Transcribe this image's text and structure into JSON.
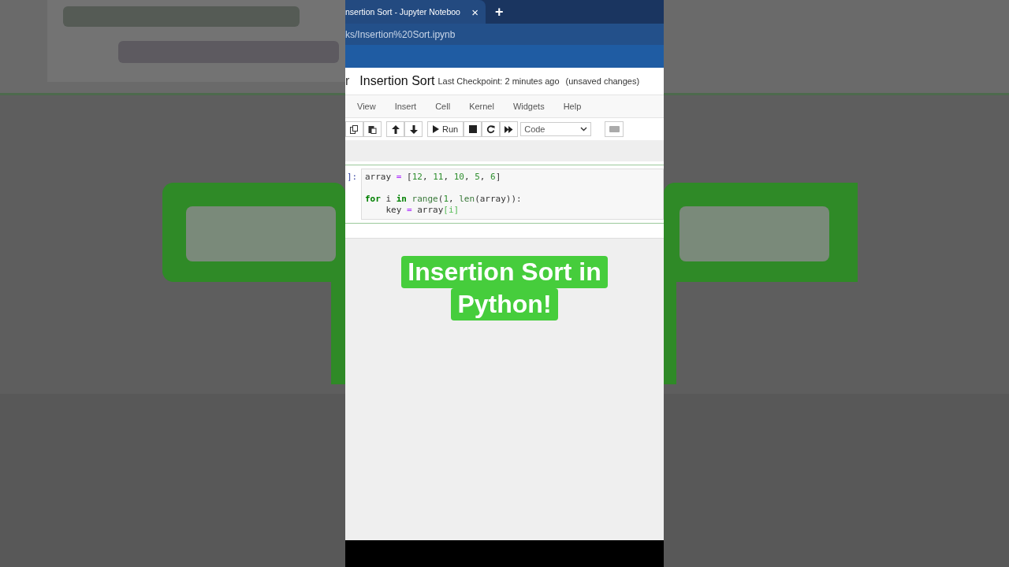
{
  "browser": {
    "tab_title": "nsertion Sort - Jupyter Noteboo",
    "tab_close": "×",
    "new_tab": "+",
    "url": "ks/Insertion%20Sort.ipynb"
  },
  "notebook": {
    "logo_fragment": "r",
    "title": "Insertion Sort",
    "checkpoint": "Last Checkpoint: 2 minutes ago",
    "save_status": "(unsaved changes)"
  },
  "menu": [
    "View",
    "Insert",
    "Cell",
    "Kernel",
    "Widgets",
    "Help"
  ],
  "toolbar": [
    {
      "kind": "copy"
    },
    {
      "kind": "paste"
    },
    {
      "kind": "up"
    },
    {
      "kind": "down"
    },
    {
      "kind": "run",
      "label": "Run"
    },
    {
      "kind": "stop"
    },
    {
      "kind": "restart"
    },
    {
      "kind": "fastforward"
    },
    {
      "kind": "select",
      "label": "Code"
    },
    {
      "kind": "keyboard"
    }
  ],
  "cell": {
    "prompt": "]:",
    "lines": [
      {
        "kind": "code",
        "tokens": [
          {
            "text": "array ",
            "kind": "plain"
          },
          {
            "text": "=",
            "kind": "op"
          },
          {
            "text": " [",
            "kind": "plain"
          },
          {
            "text": "12",
            "kind": "num"
          },
          {
            "text": ", ",
            "kind": "plain"
          },
          {
            "text": "11",
            "kind": "num"
          },
          {
            "text": ", ",
            "kind": "plain"
          },
          {
            "text": "10",
            "kind": "num"
          },
          {
            "text": ", ",
            "kind": "plain"
          },
          {
            "text": "5",
            "kind": "num"
          },
          {
            "text": ", ",
            "kind": "plain"
          },
          {
            "text": "6",
            "kind": "num"
          },
          {
            "text": "]",
            "kind": "plain"
          }
        ]
      },
      {
        "kind": "blank"
      },
      {
        "kind": "code",
        "tokens": [
          {
            "text": "for",
            "kind": "kw"
          },
          {
            "text": " i ",
            "kind": "plain"
          },
          {
            "text": "in",
            "kind": "kw"
          },
          {
            "text": " range",
            "kind": "builtin"
          },
          {
            "text": "(",
            "kind": "plain"
          },
          {
            "text": "1",
            "kind": "num"
          },
          {
            "text": ", ",
            "kind": "plain"
          },
          {
            "text": "len",
            "kind": "builtin"
          },
          {
            "text": "(array)):",
            "kind": "plain"
          }
        ]
      },
      {
        "kind": "code",
        "tokens": [
          {
            "text": "    key ",
            "kind": "plain"
          },
          {
            "text": "=",
            "kind": "op"
          },
          {
            "text": " array",
            "kind": "plain"
          },
          {
            "text": "[i]",
            "kind": "match"
          }
        ]
      }
    ]
  },
  "caption": [
    "Insertion Sort in",
    "Python!"
  ]
}
